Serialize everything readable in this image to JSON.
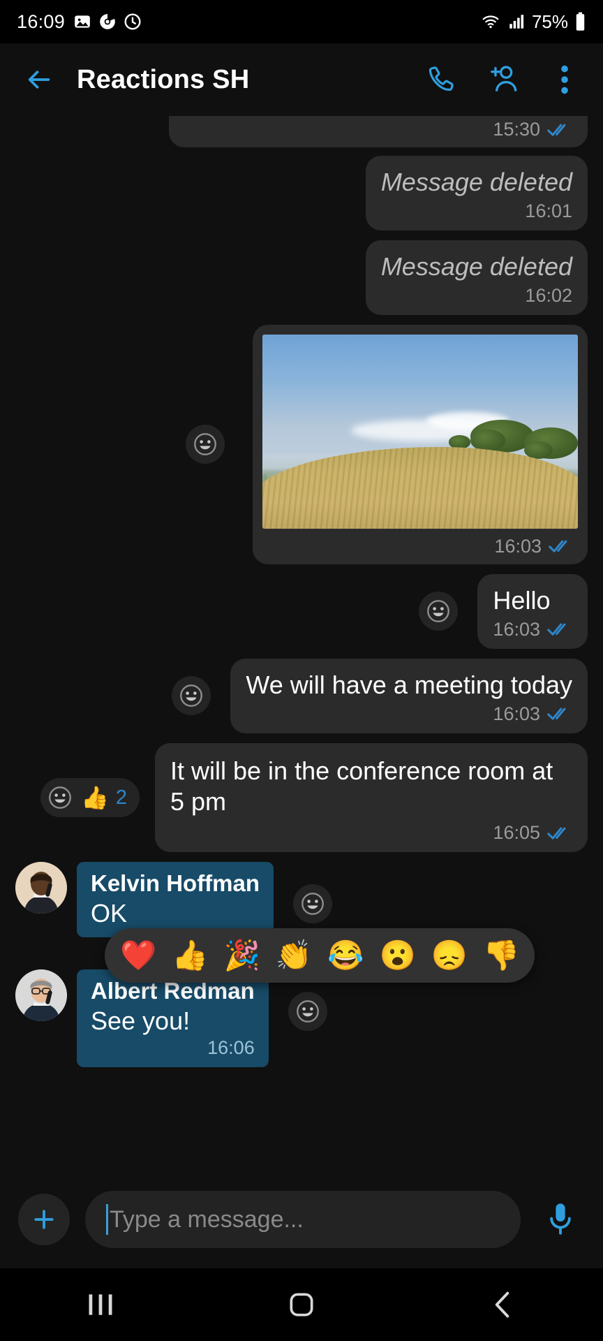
{
  "status_bar": {
    "time": "16:09",
    "battery_percent": "75%",
    "icons": [
      "gallery-icon",
      "chrome-icon",
      "clock-icon",
      "wifi-icon",
      "signal-icon",
      "battery-icon"
    ]
  },
  "app_bar": {
    "back_label": "back-arrow",
    "title": "Reactions SH",
    "actions": [
      "call-icon",
      "add-person-icon",
      "overflow-menu-icon"
    ]
  },
  "messages": [
    {
      "id": "m0",
      "direction": "out",
      "type": "partial",
      "text": "",
      "time": "15:30",
      "status": "read"
    },
    {
      "id": "m1",
      "direction": "out",
      "type": "deleted",
      "text": "Message deleted",
      "time": "16:01",
      "status": "none"
    },
    {
      "id": "m2",
      "direction": "out",
      "type": "deleted",
      "text": "Message deleted",
      "time": "16:02",
      "status": "none"
    },
    {
      "id": "m3",
      "direction": "out",
      "type": "image",
      "alt": "landscape-photo-hill-valley-sky",
      "time": "16:03",
      "status": "read"
    },
    {
      "id": "m4",
      "direction": "out",
      "type": "text",
      "text": "Hello",
      "time": "16:03",
      "status": "read"
    },
    {
      "id": "m5",
      "direction": "out",
      "type": "text",
      "text": "We will have a meeting today",
      "time": "16:03",
      "status": "read"
    },
    {
      "id": "m6",
      "direction": "out",
      "type": "text",
      "text": "It will be in the conference room at 5 pm",
      "time": "16:05",
      "status": "read",
      "reaction": {
        "emoji": "👍",
        "count": "2"
      }
    },
    {
      "id": "m7",
      "direction": "in",
      "type": "text",
      "sender": "Kelvin Hoffman",
      "text": "OK",
      "time": ""
    },
    {
      "id": "m8",
      "direction": "in",
      "type": "text",
      "sender": "Albert Redman",
      "text": "See you!",
      "time": "16:06"
    }
  ],
  "emoji_picker": {
    "visible": true,
    "emojis": [
      "❤️",
      "👍",
      "🎉",
      "👏",
      "😂",
      "😮",
      "😞",
      "👎"
    ]
  },
  "composer": {
    "attach_label": "+",
    "placeholder": "Type a message...",
    "value": "",
    "mic_label": "microphone-icon"
  },
  "nav_bar": {
    "items": [
      "recents-icon",
      "home-icon",
      "back-icon"
    ]
  },
  "colors": {
    "accent": "#2f86c9",
    "incoming_bubble": "#174b68",
    "outgoing_bubble": "#2b2b2b",
    "background": "#101010",
    "tick_read": "#2f86c9"
  }
}
